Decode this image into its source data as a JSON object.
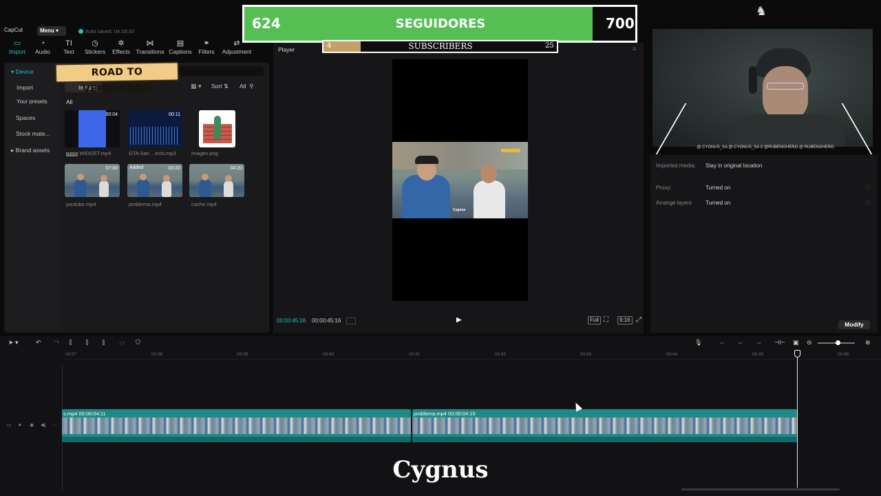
{
  "app": {
    "logo": "CapCut",
    "menu_label": "Menu",
    "autosave": "Auto saved: 04:19:33"
  },
  "toolbar": [
    {
      "label": "Import",
      "icon": "import-icon"
    },
    {
      "label": "Audio",
      "icon": "audio-icon"
    },
    {
      "label": "Text",
      "icon": "text-icon"
    },
    {
      "label": "Stickers",
      "icon": "stickers-icon"
    },
    {
      "label": "Effects",
      "icon": "effects-icon"
    },
    {
      "label": "Transitions",
      "icon": "transitions-icon"
    },
    {
      "label": "Captions",
      "icon": "captions-icon"
    },
    {
      "label": "Filters",
      "icon": "filters-icon"
    },
    {
      "label": "Adjustment",
      "icon": "adjustment-icon"
    }
  ],
  "sidenav": {
    "device": "▾ Device",
    "import": "Import",
    "presets": "Your presets",
    "spaces": "Spaces",
    "stock": "Stock mate...",
    "brand": "▸ Brand assets"
  },
  "media": {
    "import_label": "Import",
    "sort_label": "Sort",
    "all_filter": "All",
    "all_label": "All",
    "items": [
      {
        "name": "WIDGET.mp4",
        "duration": "00:04",
        "badge": "Proxy"
      },
      {
        "name": "GTA San ...ects.mp3",
        "duration": "00:11"
      },
      {
        "name": "images.png",
        "duration": ""
      },
      {
        "name": "youtube.mp4",
        "duration": "07:00"
      },
      {
        "name": "problema.mp4",
        "duration": "03:20",
        "badge": "Added"
      },
      {
        "name": "cache.mp4",
        "duration": "04:20"
      }
    ]
  },
  "banner": "ROAD TO VERIFICADO",
  "player": {
    "label": "Player",
    "tc_current": "00:00:45:16",
    "tc_total": "00:00:45:16",
    "full": "Full",
    "ratio": "9:16",
    "video_caption": "Cygnus"
  },
  "followers": {
    "current": "624",
    "label": "SEGUIDORES",
    "goal": "700",
    "progress": 0.89,
    "accent": "#56bf54"
  },
  "subscribers": {
    "current": "4",
    "label": "SUBSCRIBERS",
    "goal": "25",
    "progress": 0.16,
    "accent": "#c4a06a"
  },
  "cam": {
    "strip": "@ CYGNUS_SA   @ CYGNUS_SA   X @RUBENGHERO   @ RUBENGHERO"
  },
  "details": {
    "imported_key": "Imported media:",
    "imported_val": "Stay in original location",
    "proxy_key": "Proxy:",
    "proxy_val": "Turned on",
    "layers_key": "Arrange layers",
    "layers_val": "Turned on",
    "modify": "Modify"
  },
  "timeline": {
    "ticks": [
      "00:37",
      "00:38",
      "00:39",
      "00:40",
      "00:41",
      "00:42",
      "00:43",
      "00:44",
      "00:45",
      "00:46"
    ],
    "clips": [
      {
        "title": "s.mp4  00:00:04:11"
      },
      {
        "title": "problema.mp4  00:00:04:15"
      }
    ],
    "overlay_name": "Cygnus"
  }
}
